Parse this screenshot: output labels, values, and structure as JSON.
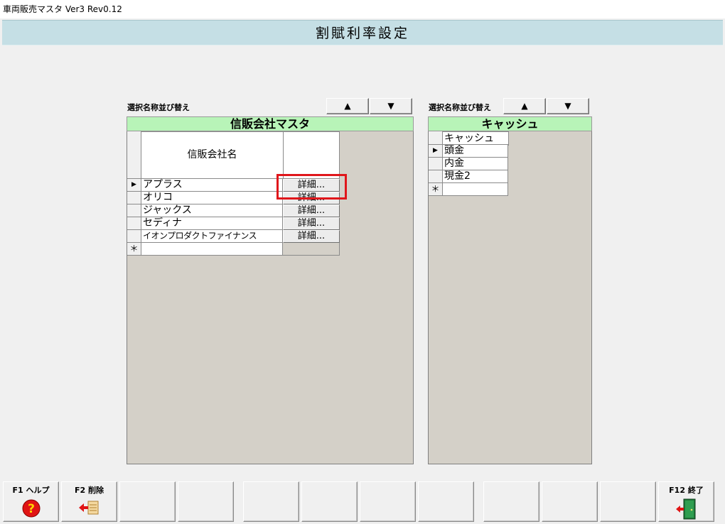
{
  "window": {
    "title": "車両販売マスタ Ver3 Rev0.12"
  },
  "header": {
    "title": "割賦利率設定"
  },
  "left_panel": {
    "sort_label": "選択名称並び替え",
    "sort_up": "▲",
    "sort_down": "▼",
    "title": "信販会社マスタ",
    "column_header": "信販会社名",
    "detail_label": "詳細...",
    "current_row_marker": "▶",
    "new_row_marker": "＊",
    "rows": [
      {
        "name": "アプラス"
      },
      {
        "name": "オリコ"
      },
      {
        "name": "ジャックス"
      },
      {
        "name": "セディナ"
      },
      {
        "name": "イオンプロダクトファイナンス"
      }
    ]
  },
  "right_panel": {
    "sort_label": "選択名称並び替え",
    "sort_up": "▲",
    "sort_down": "▼",
    "title": "キャッシュ",
    "column_header": "キャッシュ",
    "current_row_marker": "▶",
    "new_row_marker": "＊",
    "rows": [
      {
        "name": "頭金"
      },
      {
        "name": "内金"
      },
      {
        "name": "現金2"
      }
    ]
  },
  "footer": {
    "f1_label": "F1 ヘルプ",
    "f1_icon": "help-icon",
    "f2_label": "F2 削除",
    "f2_icon": "delete-arrow-icon",
    "f12_label": "F12 終了",
    "f12_icon": "exit-door-icon"
  },
  "colors": {
    "header_band": "#c5dfe5",
    "panel_title": "#b8f4b8",
    "panel_body": "#d4d0c8",
    "highlight": "#e0161b"
  }
}
